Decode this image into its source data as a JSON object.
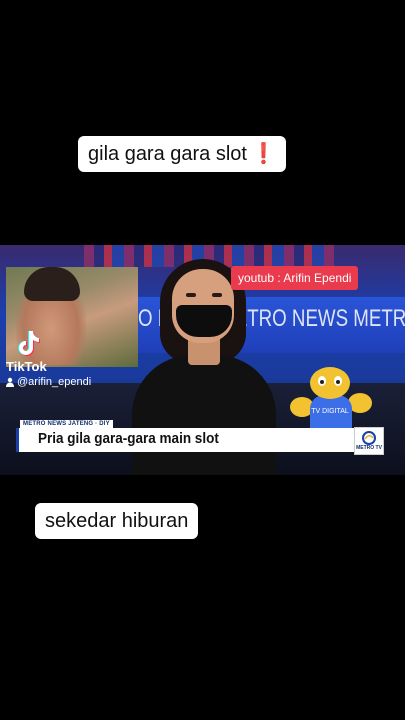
{
  "captions": {
    "top_text": "gila gara gara slot",
    "top_emoji": "❗",
    "bottom_text": "sekedar hiburan"
  },
  "video": {
    "source_badge": "youtub : Arifin Ependi",
    "wall_text": "O NEWS METRO NEWS METRO NEW",
    "ticker_label": "METRO NEWS JATENG · DIY",
    "headline": "Pria gila gara-gara main slot",
    "channel_logo_text": "METRO TV",
    "mascot_text": "TV DIGITAL"
  },
  "watermark": {
    "brand": "TikTok",
    "username": "@arifin_ependi"
  },
  "colors": {
    "badge": "#ea3a4e",
    "background": "#000000",
    "studio_blue": "#1f3fb8"
  }
}
